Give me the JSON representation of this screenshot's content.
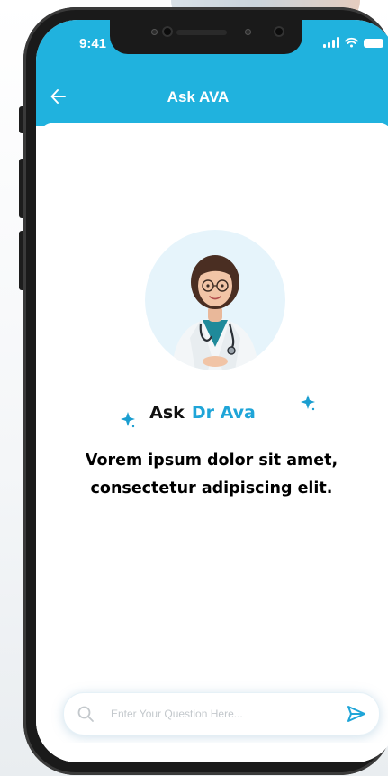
{
  "status_bar": {
    "time": "9:41"
  },
  "header": {
    "title": "Ask AVA",
    "back_icon": "arrow-left-icon"
  },
  "hero": {
    "avatar_icon": "doctor-avatar",
    "ask_label": "Ask",
    "name_label": "Dr Ava",
    "tagline": "Vorem ipsum dolor sit amet, consectetur adipiscing elit."
  },
  "question_input": {
    "placeholder": "Enter Your Question Here...",
    "value": "",
    "search_icon": "search-icon",
    "send_icon": "send-icon"
  },
  "colors": {
    "accent": "#20b2de",
    "name_accent": "#1fa5d8",
    "phone_frame": "#1a1a1a"
  }
}
